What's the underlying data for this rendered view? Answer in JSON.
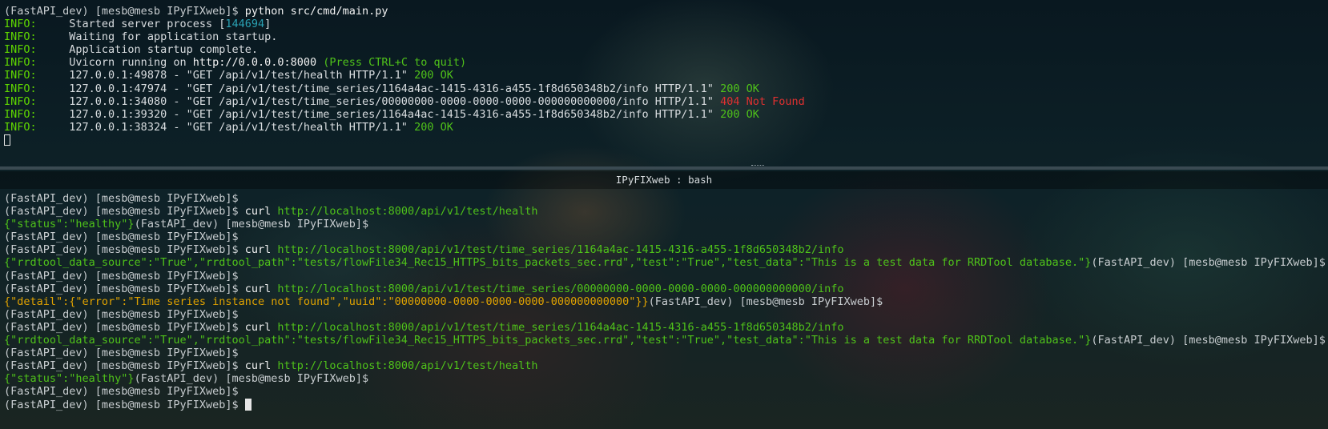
{
  "top_pane": {
    "prompt": "(FastAPI_dev) [mesb@mesb IPyFIXweb]$",
    "command": "python src/cmd/main.py",
    "logs": [
      {
        "level": "INFO:",
        "text": "Started server process [",
        "pid": "144694",
        "tail": "]"
      },
      {
        "level": "INFO:",
        "text": "Waiting for application startup."
      },
      {
        "level": "INFO:",
        "text": "Application startup complete."
      },
      {
        "level": "INFO:",
        "text": "Uvicorn running on ",
        "url": "http://0.0.0.0:8000",
        "hint": " (Press CTRL+C to quit)"
      }
    ],
    "access_logs": [
      {
        "level": "INFO:",
        "client": "127.0.0.1:49878",
        "request": "\"GET /api/v1/test/health HTTP/1.1\"",
        "status": "200 OK",
        "ok": true
      },
      {
        "level": "INFO:",
        "client": "127.0.0.1:47974",
        "request": "\"GET /api/v1/test/time_series/1164a4ac-1415-4316-a455-1f8d650348b2/info HTTP/1.1\"",
        "status": "200 OK",
        "ok": true
      },
      {
        "level": "INFO:",
        "client": "127.0.0.1:34080",
        "request": "\"GET /api/v1/test/time_series/00000000-0000-0000-0000-000000000000/info HTTP/1.1\"",
        "status": "404 Not Found",
        "ok": false
      },
      {
        "level": "INFO:",
        "client": "127.0.0.1:39320",
        "request": "\"GET /api/v1/test/time_series/1164a4ac-1415-4316-a455-1f8d650348b2/info HTTP/1.1\"",
        "status": "200 OK",
        "ok": true
      },
      {
        "level": "INFO:",
        "client": "127.0.0.1:38324",
        "request": "\"GET /api/v1/test/health HTTP/1.1\"",
        "status": "200 OK",
        "ok": true
      }
    ]
  },
  "pane_title": "IPyFIXweb : bash",
  "bottom_pane": {
    "prompt": "(FastAPI_dev) [mesb@mesb IPyFIXweb]$",
    "curl": "curl",
    "url_health": "http://localhost:8000/api/v1/test/health",
    "url_ts_ok": "http://localhost:8000/api/v1/test/time_series/1164a4ac-1415-4316-a455-1f8d650348b2/info",
    "url_ts_missing": "http://localhost:8000/api/v1/test/time_series/00000000-0000-0000-0000-000000000000/info",
    "resp_health": "{\"status\":\"healthy\"}",
    "resp_ts": "{\"rrdtool_data_source\":\"True\",\"rrdtool_path\":\"tests/flowFile34_Rec15_HTTPS_bits_packets_sec.rrd\",\"test\":\"True\",\"test_data\":\"This is a test data for RRDTool database.\"}",
    "resp_404": "{\"detail\":{\"error\":\"Time series instance not found\",\"uuid\":\"00000000-0000-0000-0000-000000000000\"}}"
  },
  "colors": {
    "info": "#5fd700",
    "ok": "#4fc21a",
    "error": "#e03030",
    "pid": "#2aa1b3",
    "error_json": "#e0a200",
    "underline": "#3d5bd6"
  }
}
